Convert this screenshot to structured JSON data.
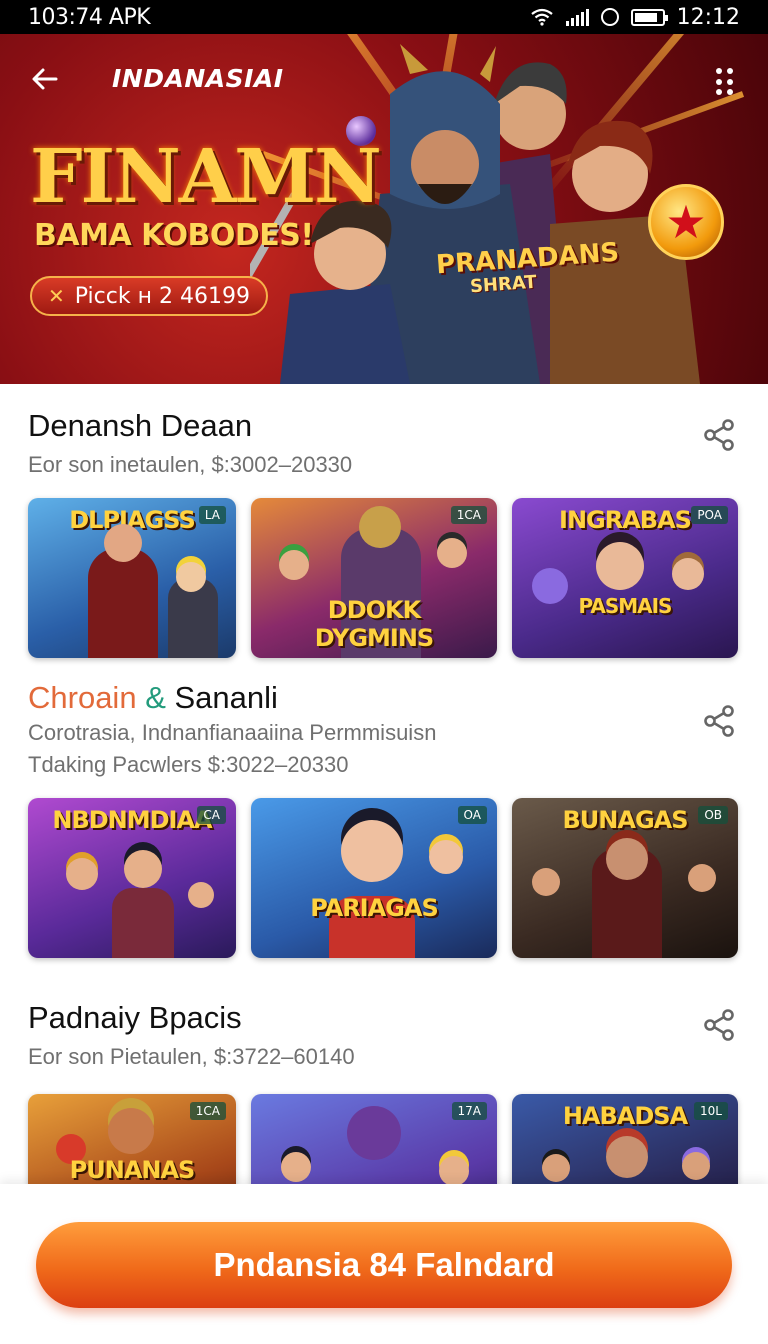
{
  "status_bar": {
    "left_text": "103:74 APK",
    "time": "12:12"
  },
  "hero": {
    "title": "INDANASIAI",
    "promo_title": "FINAMN",
    "promo_subtitle": "BAMA KOBODES!",
    "promo_pill": "Picck н 2 46199",
    "art_caption_1": "PRANADANS",
    "art_caption_2": "SHRAT"
  },
  "sections": [
    {
      "title": "Denansh Deaan",
      "subtitle_1": "Eor  son inetaulen,  $:3002–20330",
      "cards": [
        {
          "title": "DLPIAGSS",
          "tag": "LA"
        },
        {
          "title": "DDOKK",
          "title_2": "DYGMINS",
          "tag": "1CA"
        },
        {
          "title": "INGRABAS",
          "title_2": "PASMAIS",
          "tag": "POA"
        }
      ]
    },
    {
      "title_accent": "Chroain",
      "title_amp": "&",
      "title_rest": "Sananli",
      "subtitle_1": "Corotrasia,  Indnanfianaaiina  Permmisuisn",
      "subtitle_2": "Tdaking  Pacwlers  $:3022–20330",
      "cards": [
        {
          "title": "NBDNMDIAA",
          "tag": "CA"
        },
        {
          "title": "PARIAGAS",
          "tag": "OA"
        },
        {
          "title": "BUNAGAS",
          "tag": "OB"
        }
      ]
    },
    {
      "title": "Padnaiy Bpacis",
      "subtitle_1": "Eor  son Pietaulen,  $:3722–60140",
      "cards": [
        {
          "title": "PUNANAS",
          "tag": "1CA"
        },
        {
          "title": "",
          "tag": "17A"
        },
        {
          "title": "HABADSA",
          "tag": "10L"
        }
      ]
    }
  ],
  "cta": {
    "label": "Pndansia 84 Falndard"
  },
  "colors": {
    "accent": "#f06a1a",
    "section_accent": "#e26a3a",
    "amp": "#239b7c"
  }
}
